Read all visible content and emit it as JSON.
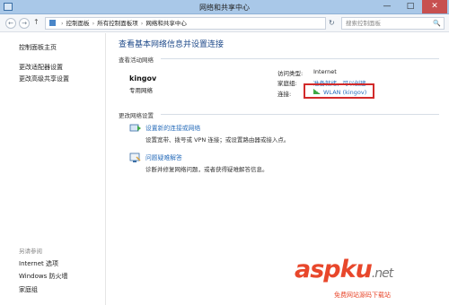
{
  "window": {
    "title": "网络和共享中心",
    "minimize_glyph": "—",
    "maximize_glyph": "□",
    "close_glyph": "✕"
  },
  "address": {
    "back_glyph": "←",
    "forward_glyph": "→",
    "up_glyph": "↑",
    "crumbs": [
      "控制面板",
      "所有控制面板项",
      "网络和共享中心"
    ],
    "separator": "›",
    "refresh_glyph": "↻",
    "search_placeholder": "搜索控制面板",
    "search_glyph": "🔍"
  },
  "sidebar": {
    "links": [
      "控制面板主页",
      "更改适配器设置",
      "更改高级共享设置"
    ],
    "see_also_heading": "另请参阅",
    "see_also": [
      "Internet 选项",
      "Windows 防火墙",
      "家庭组"
    ]
  },
  "main": {
    "heading": "查看基本网络信息并设置连接",
    "active_networks_label": "查看活动网络",
    "network_name": "kingov",
    "network_type": "专用网络",
    "access_type_label": "访问类型:",
    "access_type_value": "Internet",
    "homegroup_label": "家庭组:",
    "homegroup_value": "准备就绪，可以创建",
    "connections_label": "连接:",
    "connections_value": "WLAN (kingov)",
    "change_settings_label": "更改网络设置",
    "tasks": [
      {
        "link": "设置新的连接或网络",
        "desc": "设置宽带、拨号或 VPN 连接；或设置路由器或接入点。"
      },
      {
        "link": "问题疑难解答",
        "desc": "诊断并修复网络问题，或者获得疑难解答信息。"
      }
    ]
  },
  "watermark": {
    "logo_asp": "asp",
    "logo_ku": "ku",
    "logo_net": ".net",
    "subtitle": "免费网站源码下载站"
  },
  "colors": {
    "accent": "#1f4a8a",
    "link": "#2a6ebb",
    "highlight_box": "#d22a2a",
    "titlebar": "#a9c8e8"
  }
}
